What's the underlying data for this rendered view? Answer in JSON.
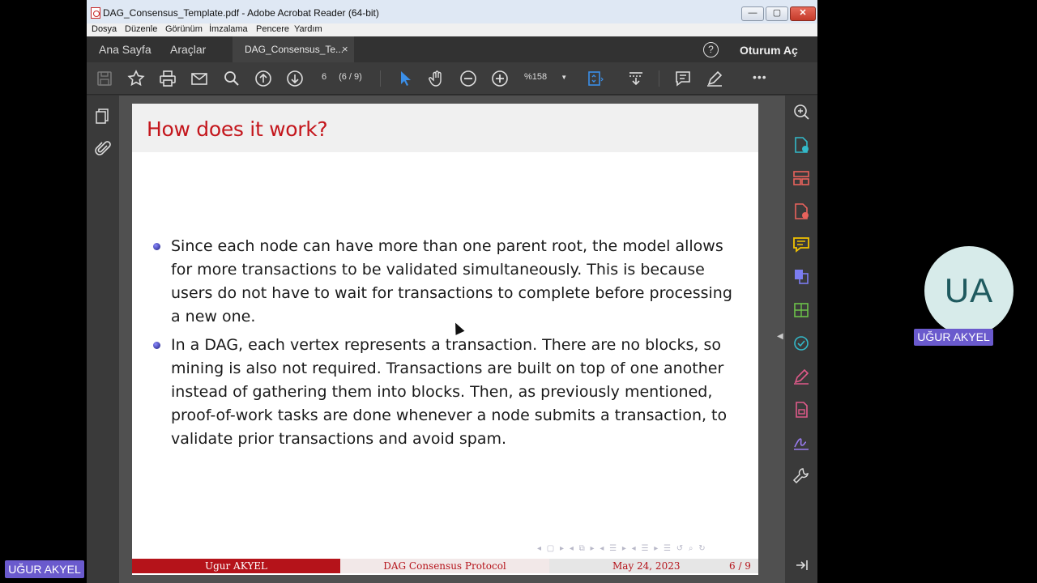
{
  "window": {
    "title": "DAG_Consensus_Template.pdf - Adobe Acrobat Reader (64-bit)",
    "controls": {
      "minimize": "—",
      "maximize": "▢",
      "close": "✕"
    }
  },
  "menu": [
    "Dosya",
    "Düzenle",
    "Görünüm",
    "İmzalama",
    "Pencere",
    "Yardım"
  ],
  "tabs": {
    "home": "Ana Sayfa",
    "tools": "Araçlar",
    "document": "DAG_Consensus_Te...",
    "close": "×",
    "help": "?",
    "signin": "Oturum Aç"
  },
  "toolbar": {
    "page_current": "6",
    "page_total": "(6 / 9)",
    "zoom": "%158",
    "more": "•••"
  },
  "slide": {
    "title": "How does it work?",
    "bullets": [
      "Since each node can have more than one parent root, the model allows for more transactions to be validated simultaneously. This is because users do not have to wait for transactions to complete before processing a new one.",
      "In a DAG, each vertex represents a transaction. There are no blocks, so mining is also not required. Transactions are built on top of one another instead of gathering them into blocks. Then, as previously mentioned, proof-of-work tasks are done whenever a node submits a transaction, to validate prior transactions and avoid spam."
    ],
    "footer": {
      "author": "Ugur AKYEL",
      "topic": "DAG Consensus Protocol",
      "date": "May 24, 2023",
      "page": "6 / 9"
    }
  },
  "participant": {
    "initials": "UA",
    "name": "UĞUR AKYEL",
    "self_name": "UĞUR AKYEL"
  },
  "colors": {
    "slide_title": "#c4161c",
    "footer_red": "#b5131a",
    "name_badge": "#6a5acd",
    "avatar_bg": "#d7ebea"
  }
}
